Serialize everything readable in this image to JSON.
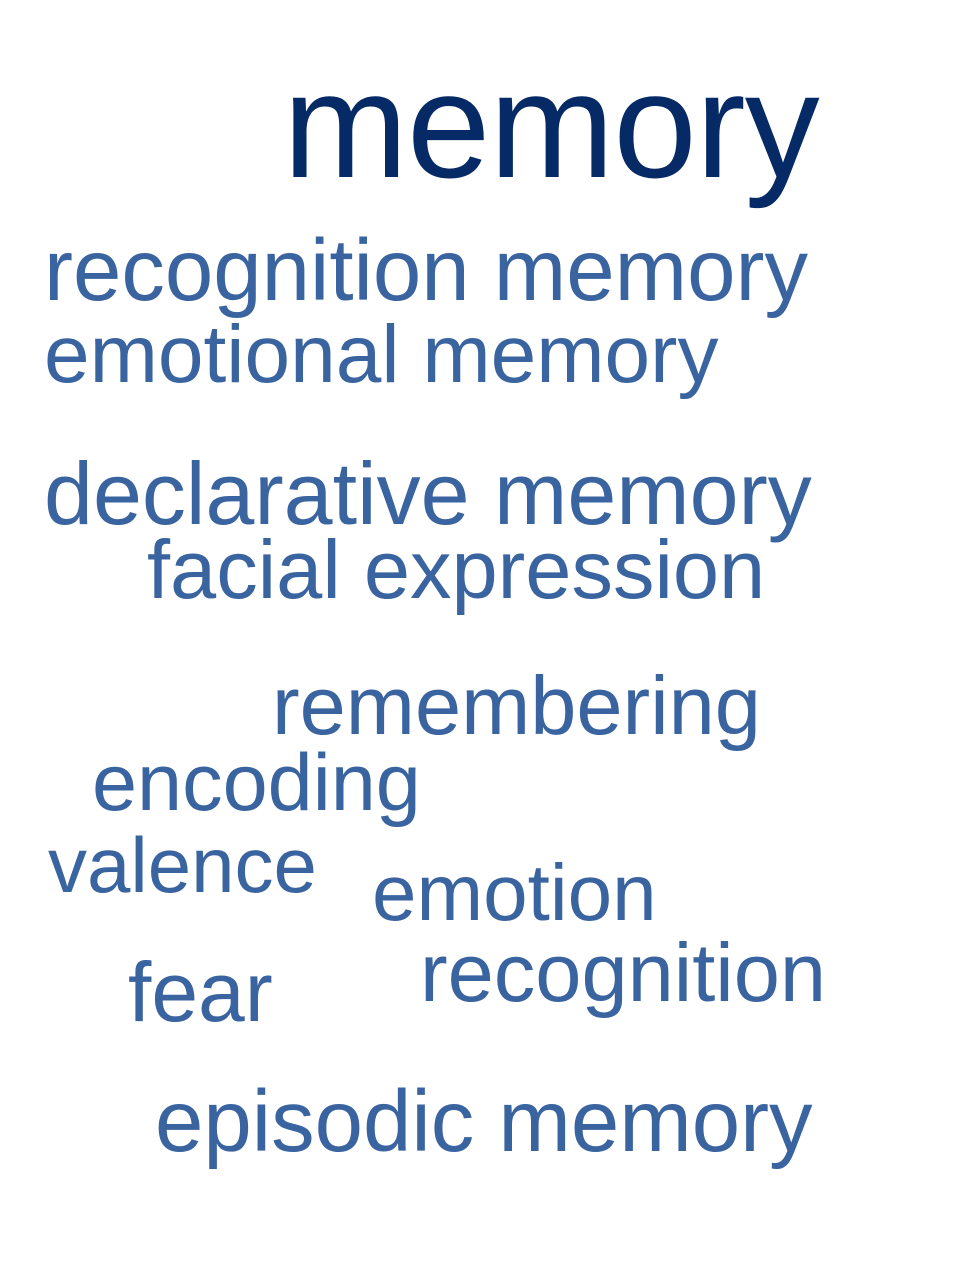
{
  "colors": {
    "primary": "#062a66",
    "secondary": "#3a64a0",
    "background": "#ffffff"
  },
  "words": {
    "memory": "memory",
    "recognition_memory": "recognition memory",
    "emotional_memory": "emotional memory",
    "declarative_memory": "declarative memory",
    "facial_expression": "facial expression",
    "remembering": "remembering",
    "encoding": "encoding",
    "valence": "valence",
    "emotion": "emotion",
    "recognition": "recognition",
    "fear": "fear",
    "episodic_memory": "episodic memory"
  }
}
